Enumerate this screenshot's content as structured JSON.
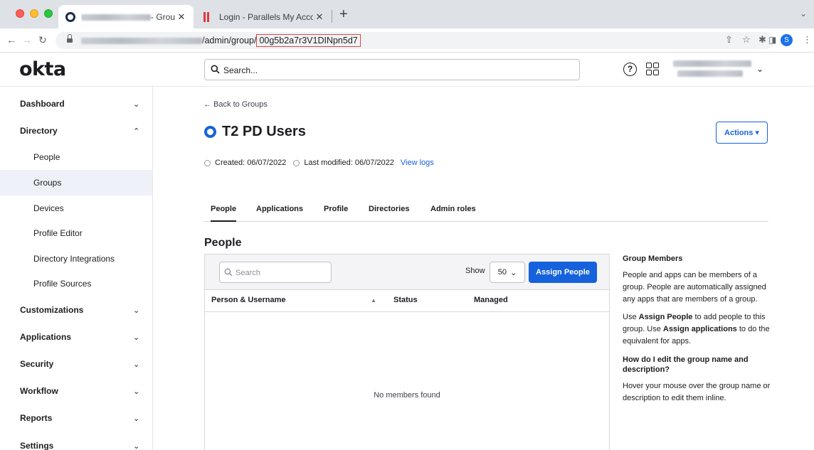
{
  "browser": {
    "tabs": [
      {
        "title_suffix": "- Group"
      },
      {
        "title": "Login - Parallels My Account"
      }
    ],
    "url": {
      "path": "/admin/group/",
      "group_id": "00g5b2a7r3V1DINpn5d7"
    },
    "profile_initial": "S"
  },
  "header": {
    "logo": "okta",
    "search_placeholder": "Search..."
  },
  "sidebar": {
    "items": [
      {
        "label": "Dashboard"
      },
      {
        "label": "Directory"
      },
      {
        "label": "People"
      },
      {
        "label": "Groups"
      },
      {
        "label": "Devices"
      },
      {
        "label": "Profile Editor"
      },
      {
        "label": "Directory Integrations"
      },
      {
        "label": "Profile Sources"
      },
      {
        "label": "Customizations"
      },
      {
        "label": "Applications"
      },
      {
        "label": "Security"
      },
      {
        "label": "Workflow"
      },
      {
        "label": "Reports"
      },
      {
        "label": "Settings"
      }
    ]
  },
  "main": {
    "back_link": "← Back to Groups",
    "group_name": "T2 PD Users",
    "actions_label": "Actions ▾",
    "created": "Created: 06/07/2022",
    "modified": "Last modified: 06/07/2022",
    "view_logs": "View logs",
    "tabs": [
      {
        "label": "People"
      },
      {
        "label": "Applications"
      },
      {
        "label": "Profile"
      },
      {
        "label": "Directories"
      },
      {
        "label": "Admin roles"
      }
    ],
    "section_title": "People",
    "people_search_placeholder": "Search",
    "show_label": "Show",
    "page_size": "50",
    "assign_people": "Assign People",
    "columns": [
      "Person & Username",
      "Status",
      "Managed"
    ],
    "empty_message": "No members found"
  },
  "aside": {
    "heading1": "Group Members",
    "para1": "People and apps can be members of a group. People are automatically assigned any apps that are members of a group.",
    "para2_a": "Use ",
    "para2_b": "Assign People",
    "para2_c": " to add people to this group. Use ",
    "para2_d": "Assign applications",
    "para2_e": " to do the equivalent for apps.",
    "heading2": "How do I edit the group name and description?",
    "para3": "Hover your mouse over the group name or description to edit them inline."
  }
}
